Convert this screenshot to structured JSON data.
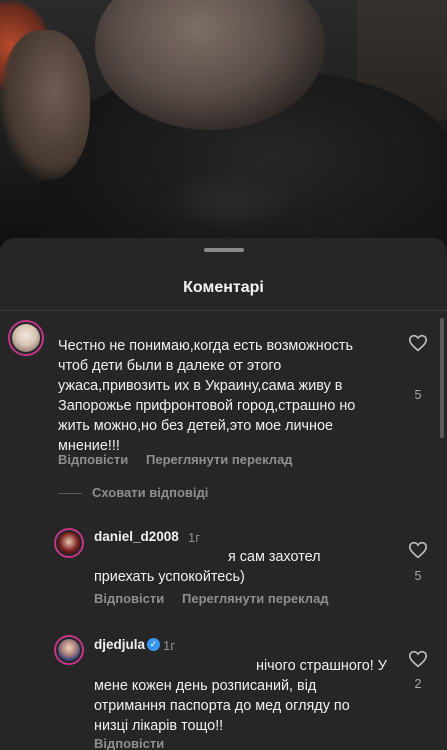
{
  "sheet": {
    "title": "Коментарі"
  },
  "comments": [
    {
      "text": "Честно не понимаю,когда есть возможность\nчтоб дети были в далеке от этого\nужаса,привозить их в Украину,сама живу в\nЗапорожье прифронтовой город,страшно но\nжить можно,но без детей,это мое личное\nмнение!!!",
      "likes": "5",
      "reply_label": "Відповісти",
      "translate_label": "Переглянути переклад"
    }
  ],
  "hide_replies_label": "Сховати відповіді",
  "replies": [
    {
      "username": "daniel_d2008",
      "time": "1г",
      "text": "я сам захотел\nприехать успокойтесь)",
      "likes": "5",
      "reply_label": "Відповісти",
      "translate_label": "Переглянути переклад"
    },
    {
      "username": "djedjula",
      "time": "1г",
      "text": "нічого страшного! У\nмене кожен день розписаний, від\nотримання паспорта до мед огляду по\nнизці лікарів тощо!!",
      "likes": "2",
      "reply_label": "Відповісти"
    }
  ],
  "colors": {
    "sheet_bg": "#262626",
    "secondary_text": "#8e8e8e",
    "verified": "#3897f0",
    "avatar_ring": "#c13584"
  },
  "icons": {
    "like": "heart-outline-icon",
    "verified": "verified-badge-icon"
  }
}
